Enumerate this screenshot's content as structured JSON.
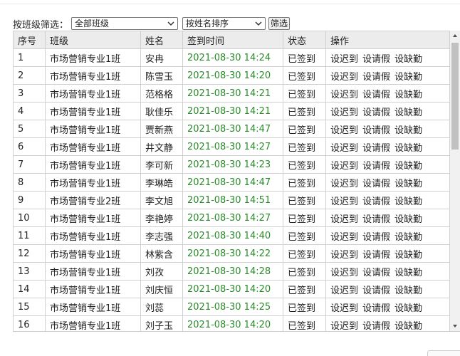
{
  "filter": {
    "label": "按班级筛选：",
    "class_select_value": "全部班级",
    "sort_select_value": "按姓名排序",
    "filter_button": "筛选"
  },
  "table": {
    "headers": [
      "序号",
      "班级",
      "姓名",
      "签到时间",
      "状态",
      "操作"
    ],
    "actions": [
      "设迟到",
      "设请假",
      "设缺勤"
    ],
    "rows": [
      {
        "no": "1",
        "cls": "市场营销专业1班",
        "name": "安冉",
        "time": "2021-08-30 14:24",
        "status": "已签到"
      },
      {
        "no": "2",
        "cls": "市场营销专业1班",
        "name": "陈雪玉",
        "time": "2021-08-30 14:20",
        "status": "已签到"
      },
      {
        "no": "3",
        "cls": "市场营销专业1班",
        "name": "范格格",
        "time": "2021-08-30 14:21",
        "status": "已签到"
      },
      {
        "no": "4",
        "cls": "市场营销专业1班",
        "name": "耿佳乐",
        "time": "2021-08-30 14:21",
        "status": "已签到"
      },
      {
        "no": "5",
        "cls": "市场营销专业1班",
        "name": "贾新燕",
        "time": "2021-08-30 14:47",
        "status": "已签到"
      },
      {
        "no": "6",
        "cls": "市场营销专业1班",
        "name": "井文静",
        "time": "2021-08-30 14:27",
        "status": "已签到"
      },
      {
        "no": "7",
        "cls": "市场营销专业1班",
        "name": "李可新",
        "time": "2021-08-30 14:23",
        "status": "已签到"
      },
      {
        "no": "8",
        "cls": "市场营销专业1班",
        "name": "李琳皓",
        "time": "2021-08-30 14:47",
        "status": "已签到"
      },
      {
        "no": "9",
        "cls": "市场营销专业2班",
        "name": "李文旭",
        "time": "2021-08-30 14:51",
        "status": "已签到"
      },
      {
        "no": "10",
        "cls": "市场营销专业1班",
        "name": "李艳婷",
        "time": "2021-08-30 14:27",
        "status": "已签到"
      },
      {
        "no": "11",
        "cls": "市场营销专业1班",
        "name": "李志强",
        "time": "2021-08-30 14:40",
        "status": "已签到"
      },
      {
        "no": "12",
        "cls": "市场营销专业1班",
        "name": "林紫含",
        "time": "2021-08-30 14:22",
        "status": "已签到"
      },
      {
        "no": "13",
        "cls": "市场营销专业1班",
        "name": "刘孜",
        "time": "2021-08-30 14:28",
        "status": "已签到"
      },
      {
        "no": "14",
        "cls": "市场营销专业1班",
        "name": "刘庆恒",
        "time": "2021-08-30 14:20",
        "status": "已签到"
      },
      {
        "no": "15",
        "cls": "市场营销专业1班",
        "name": "刘蕊",
        "time": "2021-08-30 14:25",
        "status": "已签到"
      },
      {
        "no": "16",
        "cls": "市场营销专业1班",
        "name": "刘子玉",
        "time": "2021-08-30 14:20",
        "status": "已签到"
      }
    ]
  },
  "colors": {
    "time_text": "#2a8a2a",
    "header_bg": "#ececec"
  },
  "icons": {
    "select_arrow": "chevron-down-icon",
    "scroll_up": "triangle-up-icon",
    "scroll_down": "triangle-down-icon"
  }
}
